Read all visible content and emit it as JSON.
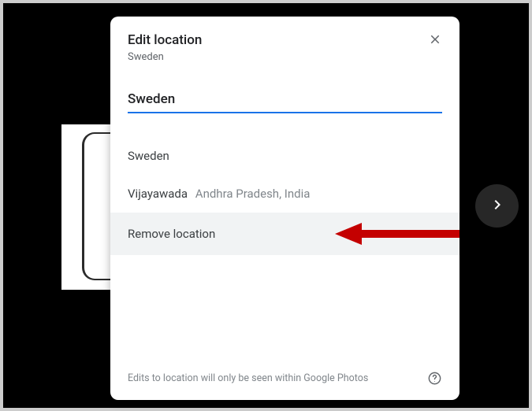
{
  "dialog": {
    "title": "Edit location",
    "subtitle": "Sweden",
    "search_value": "Sweden",
    "suggestions": [
      {
        "primary": "Sweden",
        "secondary": ""
      },
      {
        "primary": "Vijayawada",
        "secondary": "Andhra Pradesh, India"
      }
    ],
    "remove_label": "Remove location",
    "footer_note": "Edits to location will only be seen within Google Photos"
  }
}
